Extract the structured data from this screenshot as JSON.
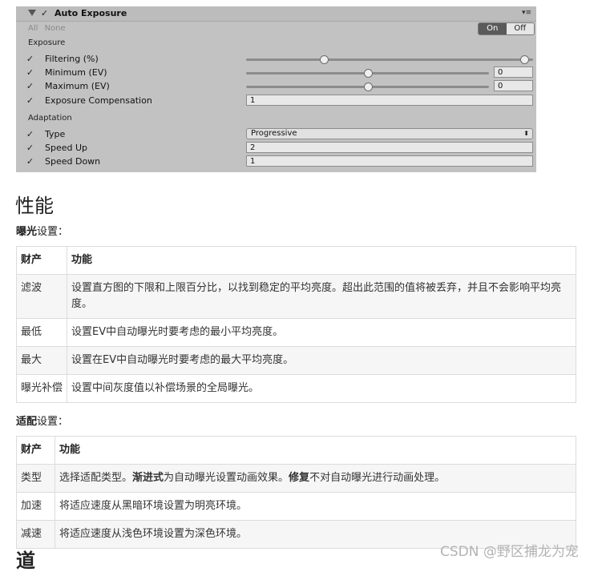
{
  "inspector": {
    "title": "Auto Exposure",
    "enabled_mark": "✓",
    "menu_glyph": "▾≡",
    "all_label": "All",
    "none_label": "None",
    "toggle_on": "On",
    "toggle_off": "Off",
    "exposure_section": "Exposure",
    "adaptation_section": "Adaptation",
    "rows": {
      "filtering": {
        "label": "Filtering (%)",
        "range_low": 0.27,
        "range_high": 0.97
      },
      "minimum": {
        "label": "Minimum (EV)",
        "value": "0",
        "slider_fraction": 0.5
      },
      "maximum": {
        "label": "Maximum (EV)",
        "value": "0",
        "slider_fraction": 0.5
      },
      "compensation": {
        "label": "Exposure Compensation",
        "value": "1"
      },
      "type": {
        "label": "Type",
        "value": "Progressive",
        "options_glyph": "⬍"
      },
      "speed_up": {
        "label": "Speed Up",
        "value": "2"
      },
      "speed_down": {
        "label": "Speed Down",
        "value": "1"
      }
    }
  },
  "doc": {
    "title": "性能",
    "exposure_caption_bold": "曝光",
    "exposure_caption_rest": "设置：",
    "exposure_table": {
      "headers": [
        "财产",
        "功能"
      ],
      "rows": [
        [
          "滤波",
          "设置直方图的下限和上限百分比，以找到稳定的平均亮度。超出此范围的值将被丢弃，并且不会影响平均亮度。"
        ],
        [
          "最低",
          "设置EV中自动曝光时要考虑的最小平均亮度。"
        ],
        [
          "最大",
          "设置在EV中自动曝光时要考虑的最大平均亮度。"
        ],
        [
          "曝光补偿",
          "设置中间灰度值以补偿场景的全局曝光。"
        ]
      ]
    },
    "adaptation_caption_bold": "适配",
    "adaptation_caption_rest": "设置：",
    "adaptation_table": {
      "headers": [
        "财产",
        "功能"
      ],
      "rows": {
        "type": {
          "name": "类型",
          "p1": "选择适配类型。",
          "b1": "渐进式",
          "p2": "为自动曝光设置动画效果。",
          "b2": "修复",
          "p3": "不对自动曝光进行动画处理。"
        },
        "speed_up": {
          "name": "加速",
          "desc": "将适应速度从黑暗环境设置为明亮环境。"
        },
        "speed_down": {
          "name": "减速",
          "desc": "将适应速度从浅色环境设置为深色环境。"
        }
      }
    },
    "next_heading_partial": "道"
  },
  "watermark": "CSDN @野区捕龙为宠",
  "colors": {
    "panel_bg": "#c2c2c2",
    "toggle_on_bg": "#5a5a5a",
    "table_border": "#dcdcdc",
    "watermark": "#b3b3b3"
  }
}
